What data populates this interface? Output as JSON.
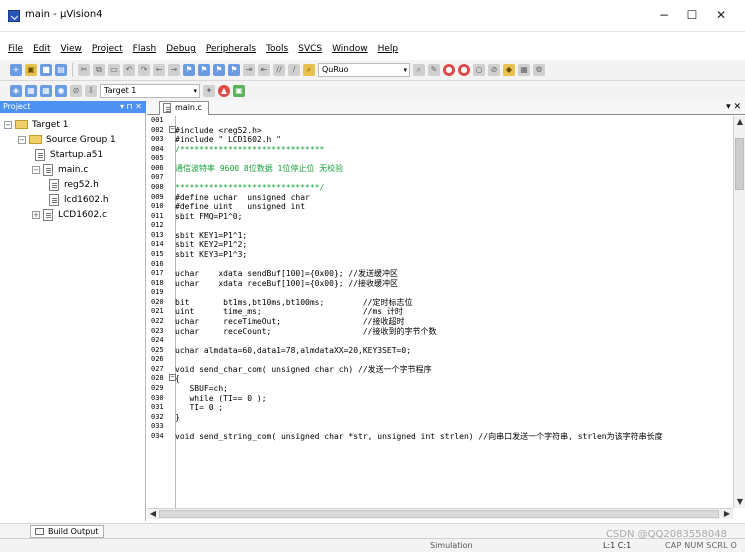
{
  "window": {
    "title": "main - µVision4",
    "controls": [
      "−",
      "☐",
      "✕"
    ]
  },
  "menu": [
    "File",
    "Edit",
    "View",
    "Project",
    "Flash",
    "Debug",
    "Peripherals",
    "Tools",
    "SVCS",
    "Window",
    "Help"
  ],
  "toolbar": {
    "target_select": "Target 1",
    "search_select": "QuRuo"
  },
  "project": {
    "pane_title": "Project",
    "pane_controls": "▾ ⊓ ✕",
    "target": "Target 1",
    "group": "Source Group 1",
    "files": [
      "Startup.a51",
      "main.c",
      "reg52.h",
      "lcd1602.h",
      "LCD1602.c"
    ]
  },
  "editor": {
    "tab": "main.c",
    "controls": "▾ ✕",
    "lines": [
      {
        "no": "001",
        "text": ""
      },
      {
        "no": "002",
        "text": "#include <reg52.h>",
        "fold": "−"
      },
      {
        "no": "003",
        "text": "#include \" LCD1602.h \""
      },
      {
        "no": "004",
        "text": "/******************************",
        "style": "green"
      },
      {
        "no": "005",
        "text": ""
      },
      {
        "no": "006",
        "text": "通信波特率 9600 8位数据 1位停止位 无校验",
        "style": "green"
      },
      {
        "no": "007",
        "text": ""
      },
      {
        "no": "008",
        "text": "******************************/",
        "style": "green"
      },
      {
        "no": "009",
        "text": "#define uchar  unsigned char"
      },
      {
        "no": "010",
        "text": "#define uint   unsigned int"
      },
      {
        "no": "011",
        "text": "sbit FMQ=P1^0;"
      },
      {
        "no": "012",
        "text": ""
      },
      {
        "no": "013",
        "text": "sbit KEY1=P1^1;"
      },
      {
        "no": "014",
        "text": "sbit KEY2=P1^2;"
      },
      {
        "no": "015",
        "text": "sbit KEY3=P1^3;"
      },
      {
        "no": "016",
        "text": ""
      },
      {
        "no": "017",
        "text": "uchar    xdata sendBuf[100]={0x00}; //发送缓冲区"
      },
      {
        "no": "018",
        "text": "uchar    xdata receBuf[100]={0x00}; //接收缓冲区"
      },
      {
        "no": "019",
        "text": ""
      },
      {
        "no": "020",
        "text": "bit       bt1ms,bt10ms,bt100ms;        //定时标志位"
      },
      {
        "no": "021",
        "text": "uint      time_ms;                     //ms 计时"
      },
      {
        "no": "022",
        "text": "uchar     receTimeOut;                 //接收超时"
      },
      {
        "no": "023",
        "text": "uchar     receCount;                   //接收到的字节个数"
      },
      {
        "no": "024",
        "text": ""
      },
      {
        "no": "025",
        "text": "uchar almdata=60,data1=78,almdataXX=20,KEY3SET=0;"
      },
      {
        "no": "026",
        "text": ""
      },
      {
        "no": "027",
        "text": "void send_char_com( unsigned char ch) //发送一个字节程序"
      },
      {
        "no": "028",
        "text": "{",
        "fold": "−"
      },
      {
        "no": "029",
        "text": "   SBUF=ch;"
      },
      {
        "no": "030",
        "text": "   while (TI== 0 );"
      },
      {
        "no": "031",
        "text": "   TI= 0 ;"
      },
      {
        "no": "032",
        "text": "}"
      },
      {
        "no": "033",
        "text": ""
      },
      {
        "no": "034",
        "text": "void send_string_com( unsigned char *str, unsigned int strlen) //向串口发送一个字符串, strlen为该字符串长度"
      }
    ]
  },
  "bottom": {
    "build_output": "Build Output",
    "status_sim": "Simulation",
    "status_pos": "L:1 C:1",
    "status_caps": "CAP  NUM  SCRL  O",
    "watermark": "CSDN @QQ2083558048"
  },
  "colors": {
    "accent": "#4d91f2",
    "comment": "#19a13a"
  }
}
